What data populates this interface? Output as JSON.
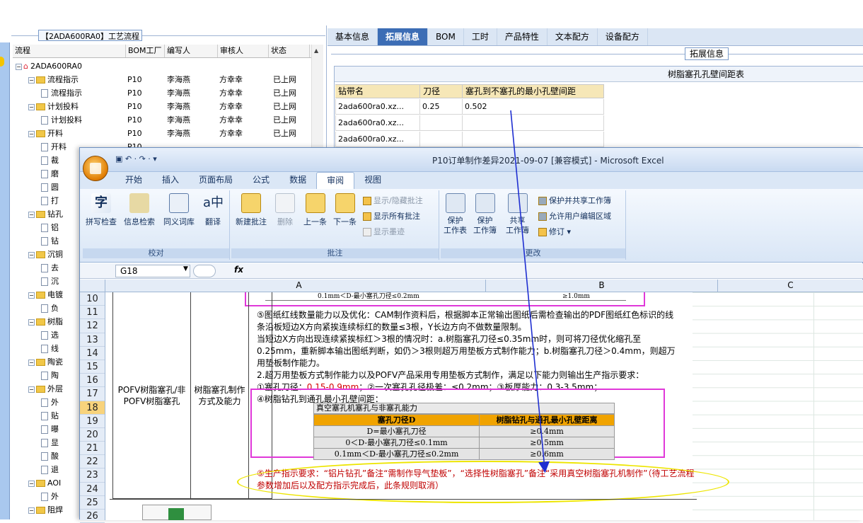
{
  "left_panel": {
    "title": "【2ADA600RA0】工艺流程",
    "headers": [
      "流程",
      "BOM工厂",
      "编写人",
      "审核人",
      "状态"
    ],
    "rows": [
      {
        "indent": 0,
        "type": "root",
        "name": "2ADA600RA0",
        "bom": "",
        "writer": "",
        "reviewer": "",
        "status": ""
      },
      {
        "indent": 1,
        "type": "folder",
        "name": "流程指示",
        "bom": "P10",
        "writer": "李海燕",
        "reviewer": "方幸幸",
        "status": "已上网"
      },
      {
        "indent": 2,
        "type": "doc",
        "name": "流程指示",
        "bom": "P10",
        "writer": "李海燕",
        "reviewer": "方幸幸",
        "status": "已上网"
      },
      {
        "indent": 1,
        "type": "folder",
        "name": "计划投料",
        "bom": "P10",
        "writer": "李海燕",
        "reviewer": "方幸幸",
        "status": "已上网"
      },
      {
        "indent": 2,
        "type": "doc",
        "name": "计划投料",
        "bom": "P10",
        "writer": "李海燕",
        "reviewer": "方幸幸",
        "status": "已上网"
      },
      {
        "indent": 1,
        "type": "folder",
        "name": "开料",
        "bom": "P10",
        "writer": "李海燕",
        "reviewer": "方幸幸",
        "status": "已上网"
      },
      {
        "indent": 2,
        "type": "doc",
        "name": "开料",
        "bom": "P10",
        "writer": "",
        "reviewer": "",
        "status": ""
      },
      {
        "indent": 2,
        "type": "doc",
        "name": "裁",
        "bom": "",
        "writer": "",
        "reviewer": "",
        "status": ""
      },
      {
        "indent": 2,
        "type": "doc",
        "name": "磨",
        "bom": "",
        "writer": "",
        "reviewer": "",
        "status": ""
      },
      {
        "indent": 2,
        "type": "doc",
        "name": "圆",
        "bom": "",
        "writer": "",
        "reviewer": "",
        "status": ""
      },
      {
        "indent": 2,
        "type": "doc",
        "name": "打",
        "bom": "",
        "writer": "",
        "reviewer": "",
        "status": ""
      },
      {
        "indent": 1,
        "type": "folder",
        "name": "钻孔",
        "bom": "",
        "writer": "",
        "reviewer": "",
        "status": ""
      },
      {
        "indent": 2,
        "type": "doc",
        "name": "铝",
        "bom": "",
        "writer": "",
        "reviewer": "",
        "status": ""
      },
      {
        "indent": 2,
        "type": "doc",
        "name": "钻",
        "bom": "",
        "writer": "",
        "reviewer": "",
        "status": ""
      },
      {
        "indent": 1,
        "type": "folder",
        "name": "沉铜",
        "bom": "",
        "writer": "",
        "reviewer": "",
        "status": ""
      },
      {
        "indent": 2,
        "type": "doc",
        "name": "去",
        "bom": "",
        "writer": "",
        "reviewer": "",
        "status": ""
      },
      {
        "indent": 2,
        "type": "doc",
        "name": "沉",
        "bom": "",
        "writer": "",
        "reviewer": "",
        "status": ""
      },
      {
        "indent": 1,
        "type": "folder",
        "name": "电镀",
        "bom": "",
        "writer": "",
        "reviewer": "",
        "status": ""
      },
      {
        "indent": 2,
        "type": "doc",
        "name": "负",
        "bom": "",
        "writer": "",
        "reviewer": "",
        "status": ""
      },
      {
        "indent": 1,
        "type": "folder",
        "name": "树脂",
        "bom": "",
        "writer": "",
        "reviewer": "",
        "status": ""
      },
      {
        "indent": 2,
        "type": "doc",
        "name": "选",
        "bom": "",
        "writer": "",
        "reviewer": "",
        "status": ""
      },
      {
        "indent": 2,
        "type": "doc",
        "name": "线",
        "bom": "",
        "writer": "",
        "reviewer": "",
        "status": ""
      },
      {
        "indent": 1,
        "type": "folder",
        "name": "陶瓷",
        "bom": "",
        "writer": "",
        "reviewer": "",
        "status": ""
      },
      {
        "indent": 2,
        "type": "doc",
        "name": "陶",
        "bom": "",
        "writer": "",
        "reviewer": "",
        "status": ""
      },
      {
        "indent": 1,
        "type": "folder",
        "name": "外层",
        "bom": "",
        "writer": "",
        "reviewer": "",
        "status": ""
      },
      {
        "indent": 2,
        "type": "doc",
        "name": "外",
        "bom": "",
        "writer": "",
        "reviewer": "",
        "status": ""
      },
      {
        "indent": 2,
        "type": "doc",
        "name": "贴",
        "bom": "",
        "writer": "",
        "reviewer": "",
        "status": ""
      },
      {
        "indent": 2,
        "type": "doc",
        "name": "曝",
        "bom": "",
        "writer": "",
        "reviewer": "",
        "status": ""
      },
      {
        "indent": 2,
        "type": "doc",
        "name": "显",
        "bom": "",
        "writer": "",
        "reviewer": "",
        "status": ""
      },
      {
        "indent": 2,
        "type": "doc",
        "name": "酸",
        "bom": "",
        "writer": "",
        "reviewer": "",
        "status": ""
      },
      {
        "indent": 2,
        "type": "doc",
        "name": "退",
        "bom": "",
        "writer": "",
        "reviewer": "",
        "status": ""
      },
      {
        "indent": 1,
        "type": "folder",
        "name": "AOI",
        "bom": "",
        "writer": "",
        "reviewer": "",
        "status": ""
      },
      {
        "indent": 2,
        "type": "doc",
        "name": "外",
        "bom": "",
        "writer": "",
        "reviewer": "",
        "status": ""
      },
      {
        "indent": 1,
        "type": "folder",
        "name": "阻焊",
        "bom": "",
        "writer": "",
        "reviewer": "",
        "status": ""
      }
    ]
  },
  "right_panel": {
    "tabs": [
      "基本信息",
      "拓展信息",
      "BOM",
      "工时",
      "产品特性",
      "文本配方",
      "设备配方"
    ],
    "active_tab": "拓展信息",
    "section_label": "拓展信息",
    "grid_title": "树脂塞孔孔壁间距表",
    "grid_headers": [
      "钻带名",
      "刀径",
      "塞孔到不塞孔的最小孔壁间距"
    ],
    "grid_rows": [
      [
        "2ada600ra0.xz...",
        "0.25",
        "0.502"
      ],
      [
        "2ada600ra0.xz...",
        "",
        ""
      ],
      [
        "2ada600ra0.xz...",
        "",
        ""
      ]
    ]
  },
  "excel": {
    "caption": "P10订单制作差异2021-09-07  [兼容模式] - Microsoft Excel",
    "ribbon_tabs": [
      "开始",
      "插入",
      "页面布局",
      "公式",
      "数据",
      "审阅",
      "视图"
    ],
    "active_ribbon_tab": "审阅",
    "groups": {
      "proofing": {
        "label": "校对",
        "buttons": [
          "拼写检查",
          "信息检索",
          "同义词库",
          "翻译"
        ]
      },
      "comments": {
        "label": "批注",
        "buttons": [
          "新建批注",
          "删除",
          "上一条",
          "下一条"
        ],
        "small": [
          "显示/隐藏批注",
          "显示所有批注",
          "显示墨迹"
        ]
      },
      "changes": {
        "label": "更改",
        "buttons": [
          "保护\n工作表",
          "保护\n工作簿",
          "共享\n工作簿"
        ],
        "small": [
          "保护并共享工作簿",
          "允许用户编辑区域",
          "修订"
        ]
      }
    },
    "name_box": "G18",
    "fx_label": "fx",
    "columns": [
      "A",
      "B",
      "C"
    ],
    "rows": [
      "10",
      "11",
      "12",
      "13",
      "14",
      "15",
      "16",
      "17",
      "18",
      "19",
      "20",
      "21",
      "22",
      "23",
      "24",
      "25",
      "26"
    ],
    "selected_row": "18",
    "top_residual_left": "0.1mm＜D-最小塞孔刀径≤0.2mm",
    "top_residual_right": "≥1.0mm",
    "cell_a1": "POFV树脂塞孔/非POFV树脂塞孔",
    "cell_a2": "树脂塞孔制作方式及能力",
    "para1": "⑤图纸红线数量能力以及优化：CAM制作资料后，根据脚本正常输出图纸后需检查输出的PDF图纸红色标识的线条沿板短边X方向紧挨连续标红的数量≤3根，Y长边方向不做数量限制。",
    "para2": "当短边X方向出现连续紧挨标红＞3根的情况时：a.树脂塞孔刀径≤0.35mm时，则可将刀径优化缩孔至0.25mm，重新脚本输出图纸判断，如仍＞3根则超万用垫板方式制作能力；b.树脂塞孔刀径＞0.4mm，则超万用垫板制作能力。",
    "para3": "2.超万用垫板方式制作能力以及POFV产品采用专用垫板方式制作，满足以下能力则输出生产指示要求：",
    "para4_a": "①塞孔刀径：",
    "para4_red": "0.15-0.9mm",
    "para4_b": "；②一次塞孔孔径极差：≤0.2mm；③板厚能力：0.3-3.5mm；",
    "para5": "④树脂钻孔到通孔最小孔壁间距：",
    "inner_table": {
      "title": "真空塞孔机塞孔与非塞孔能力",
      "headers": [
        "塞孔刀径D",
        "树脂钻孔与通孔最小孔壁距离"
      ],
      "rows": [
        [
          "D=最小塞孔刀径",
          "≥0.4mm"
        ],
        [
          "0＜D-最小塞孔刀径≤0.1mm",
          "≥0.5mm"
        ],
        [
          "0.1mm＜D-最小塞孔刀径≤0.2mm",
          "≥0.6mm"
        ]
      ]
    },
    "requirement": "⑤生产指示要求：“铝片钻孔”备注“需制作导气垫板”，“选择性树脂塞孔”备注“采用真空树脂塞孔机制作”（待工艺流程参数增加后以及配方指示完成后，此条规则取消）"
  },
  "colors": {
    "accent": "#3c6db5",
    "highlight_pink": "#e038d9",
    "ellipse_yellow": "#ede500",
    "arrow_blue": "#1f2fd1"
  }
}
